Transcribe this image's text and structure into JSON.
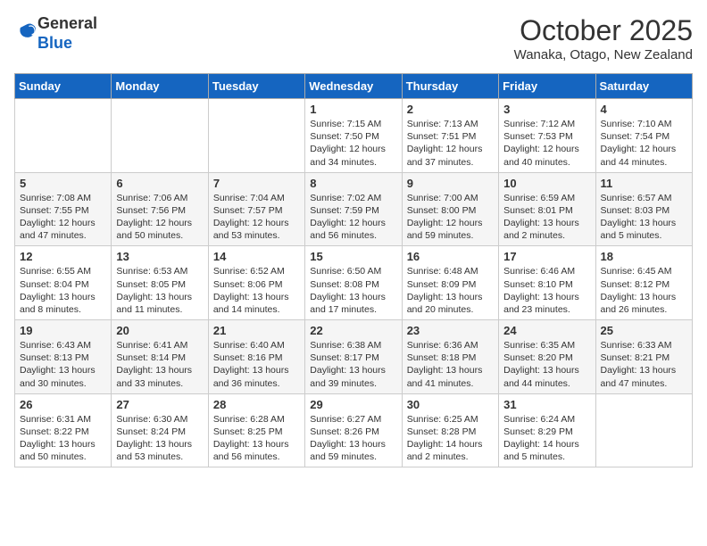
{
  "header": {
    "logo_line1": "General",
    "logo_line2": "Blue",
    "month_title": "October 2025",
    "location": "Wanaka, Otago, New Zealand"
  },
  "days_of_week": [
    "Sunday",
    "Monday",
    "Tuesday",
    "Wednesday",
    "Thursday",
    "Friday",
    "Saturday"
  ],
  "weeks": [
    [
      {
        "day": "",
        "info": ""
      },
      {
        "day": "",
        "info": ""
      },
      {
        "day": "",
        "info": ""
      },
      {
        "day": "1",
        "info": "Sunrise: 7:15 AM\nSunset: 7:50 PM\nDaylight: 12 hours and 34 minutes."
      },
      {
        "day": "2",
        "info": "Sunrise: 7:13 AM\nSunset: 7:51 PM\nDaylight: 12 hours and 37 minutes."
      },
      {
        "day": "3",
        "info": "Sunrise: 7:12 AM\nSunset: 7:53 PM\nDaylight: 12 hours and 40 minutes."
      },
      {
        "day": "4",
        "info": "Sunrise: 7:10 AM\nSunset: 7:54 PM\nDaylight: 12 hours and 44 minutes."
      }
    ],
    [
      {
        "day": "5",
        "info": "Sunrise: 7:08 AM\nSunset: 7:55 PM\nDaylight: 12 hours and 47 minutes."
      },
      {
        "day": "6",
        "info": "Sunrise: 7:06 AM\nSunset: 7:56 PM\nDaylight: 12 hours and 50 minutes."
      },
      {
        "day": "7",
        "info": "Sunrise: 7:04 AM\nSunset: 7:57 PM\nDaylight: 12 hours and 53 minutes."
      },
      {
        "day": "8",
        "info": "Sunrise: 7:02 AM\nSunset: 7:59 PM\nDaylight: 12 hours and 56 minutes."
      },
      {
        "day": "9",
        "info": "Sunrise: 7:00 AM\nSunset: 8:00 PM\nDaylight: 12 hours and 59 minutes."
      },
      {
        "day": "10",
        "info": "Sunrise: 6:59 AM\nSunset: 8:01 PM\nDaylight: 13 hours and 2 minutes."
      },
      {
        "day": "11",
        "info": "Sunrise: 6:57 AM\nSunset: 8:03 PM\nDaylight: 13 hours and 5 minutes."
      }
    ],
    [
      {
        "day": "12",
        "info": "Sunrise: 6:55 AM\nSunset: 8:04 PM\nDaylight: 13 hours and 8 minutes."
      },
      {
        "day": "13",
        "info": "Sunrise: 6:53 AM\nSunset: 8:05 PM\nDaylight: 13 hours and 11 minutes."
      },
      {
        "day": "14",
        "info": "Sunrise: 6:52 AM\nSunset: 8:06 PM\nDaylight: 13 hours and 14 minutes."
      },
      {
        "day": "15",
        "info": "Sunrise: 6:50 AM\nSunset: 8:08 PM\nDaylight: 13 hours and 17 minutes."
      },
      {
        "day": "16",
        "info": "Sunrise: 6:48 AM\nSunset: 8:09 PM\nDaylight: 13 hours and 20 minutes."
      },
      {
        "day": "17",
        "info": "Sunrise: 6:46 AM\nSunset: 8:10 PM\nDaylight: 13 hours and 23 minutes."
      },
      {
        "day": "18",
        "info": "Sunrise: 6:45 AM\nSunset: 8:12 PM\nDaylight: 13 hours and 26 minutes."
      }
    ],
    [
      {
        "day": "19",
        "info": "Sunrise: 6:43 AM\nSunset: 8:13 PM\nDaylight: 13 hours and 30 minutes."
      },
      {
        "day": "20",
        "info": "Sunrise: 6:41 AM\nSunset: 8:14 PM\nDaylight: 13 hours and 33 minutes."
      },
      {
        "day": "21",
        "info": "Sunrise: 6:40 AM\nSunset: 8:16 PM\nDaylight: 13 hours and 36 minutes."
      },
      {
        "day": "22",
        "info": "Sunrise: 6:38 AM\nSunset: 8:17 PM\nDaylight: 13 hours and 39 minutes."
      },
      {
        "day": "23",
        "info": "Sunrise: 6:36 AM\nSunset: 8:18 PM\nDaylight: 13 hours and 41 minutes."
      },
      {
        "day": "24",
        "info": "Sunrise: 6:35 AM\nSunset: 8:20 PM\nDaylight: 13 hours and 44 minutes."
      },
      {
        "day": "25",
        "info": "Sunrise: 6:33 AM\nSunset: 8:21 PM\nDaylight: 13 hours and 47 minutes."
      }
    ],
    [
      {
        "day": "26",
        "info": "Sunrise: 6:31 AM\nSunset: 8:22 PM\nDaylight: 13 hours and 50 minutes."
      },
      {
        "day": "27",
        "info": "Sunrise: 6:30 AM\nSunset: 8:24 PM\nDaylight: 13 hours and 53 minutes."
      },
      {
        "day": "28",
        "info": "Sunrise: 6:28 AM\nSunset: 8:25 PM\nDaylight: 13 hours and 56 minutes."
      },
      {
        "day": "29",
        "info": "Sunrise: 6:27 AM\nSunset: 8:26 PM\nDaylight: 13 hours and 59 minutes."
      },
      {
        "day": "30",
        "info": "Sunrise: 6:25 AM\nSunset: 8:28 PM\nDaylight: 14 hours and 2 minutes."
      },
      {
        "day": "31",
        "info": "Sunrise: 6:24 AM\nSunset: 8:29 PM\nDaylight: 14 hours and 5 minutes."
      },
      {
        "day": "",
        "info": ""
      }
    ]
  ]
}
